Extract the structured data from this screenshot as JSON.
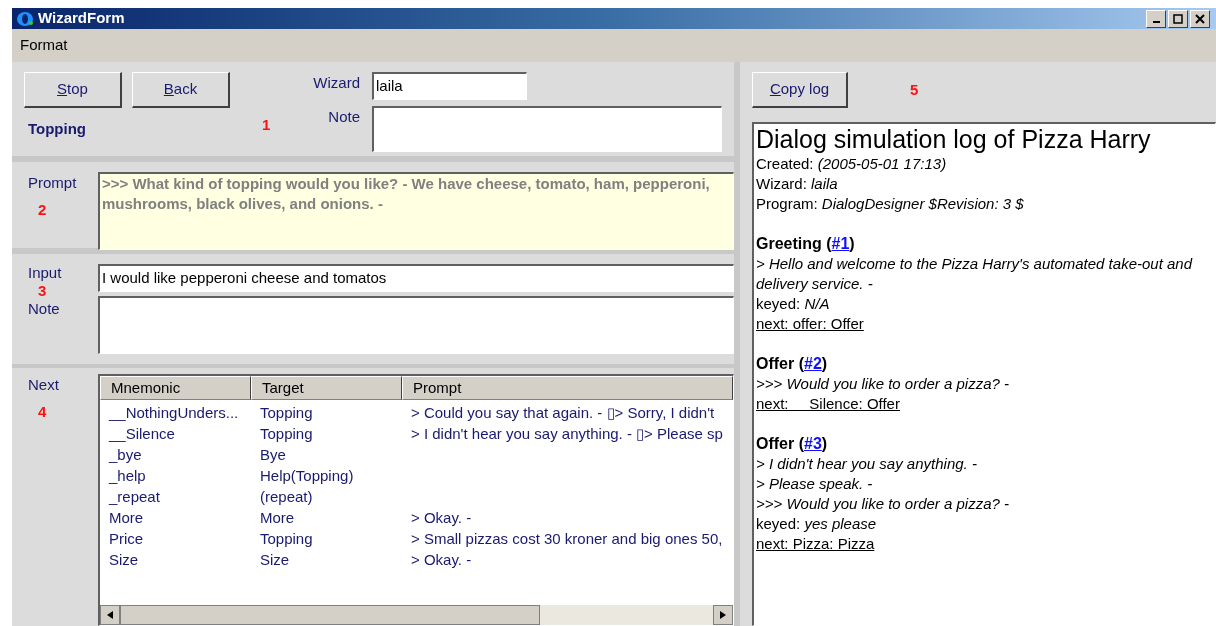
{
  "window": {
    "title": "WizardForm"
  },
  "menu": [
    "Format"
  ],
  "top": {
    "buttons": [
      {
        "label": "Stop"
      },
      {
        "label": "Back"
      }
    ],
    "state": "Topping",
    "marker": "1",
    "wizard_label": "Wizard",
    "wizard_value": "laila",
    "note_label": "Note"
  },
  "prompt": {
    "label": "Prompt",
    "marker": "2",
    "text": ">>> What kind of topping would you like? - We have cheese, tomato, ham, pepperoni, mushrooms, black olives, and onions. -"
  },
  "input": {
    "label": "Input",
    "marker": "3",
    "value": "I would like pepperoni cheese and tomatos",
    "note_label": "Note"
  },
  "next": {
    "label": "Next",
    "marker": "4",
    "columns": [
      "Mnemonic",
      "Target",
      "Prompt"
    ],
    "rows": [
      [
        "__NothingUnders...",
        "Topping",
        "> Could you say that again. - ▯> Sorry, I didn't"
      ],
      [
        "__Silence",
        "Topping",
        "> I didn't hear you say anything. - ▯> Please sp"
      ],
      [
        "_bye",
        "Bye",
        ""
      ],
      [
        "_help",
        "Help(Topping)",
        ""
      ],
      [
        "_repeat",
        "(repeat)",
        ""
      ],
      [
        "More",
        "More",
        "> Okay. -"
      ],
      [
        "Price",
        "Topping",
        "> Small pizzas cost 30 kroner and big ones 50,"
      ],
      [
        "Size",
        "Size",
        "> Okay. -"
      ]
    ]
  },
  "log_panel": {
    "copy_button": {
      "label": "Copy log"
    },
    "marker": "5",
    "title": "Dialog simulation log of Pizza Harry",
    "meta": [
      {
        "label": "Created:",
        "value": "(2005-05-01 17:13)"
      },
      {
        "label": "Wizard:",
        "value": "laila"
      },
      {
        "label": "Program:",
        "value": "DialogDesigner $Revision: 3 $"
      }
    ],
    "sections": [
      {
        "before": "Greeting (",
        "link": "#1",
        "after": ")",
        "lines": [
          {
            "kind": "prompt",
            "text": "> Hello and welcome to the Pizza Harry's automated take-out and delivery service. -"
          },
          {
            "kind": "keyed",
            "label": "keyed:",
            "value": "N/A"
          },
          {
            "kind": "next",
            "text": "next: offer: Offer"
          }
        ]
      },
      {
        "before": "Offer (",
        "link": "#2",
        "after": ")",
        "lines": [
          {
            "kind": "prompt",
            "text": ">>> Would you like to order a pizza? -"
          },
          {
            "kind": "next",
            "text": "next:     Silence: Offer"
          }
        ]
      },
      {
        "before": "Offer (",
        "link": "#3",
        "after": ")",
        "lines": [
          {
            "kind": "prompt",
            "text": "> I didn't hear you say anything. -"
          },
          {
            "kind": "prompt",
            "text": "> Please speak. -"
          },
          {
            "kind": "prompt",
            "text": ">>> Would you like to order a pizza? -"
          },
          {
            "kind": "keyed",
            "label": "keyed:",
            "value": "yes please"
          },
          {
            "kind": "next",
            "text": "next: Pizza: Pizza"
          }
        ]
      }
    ]
  }
}
